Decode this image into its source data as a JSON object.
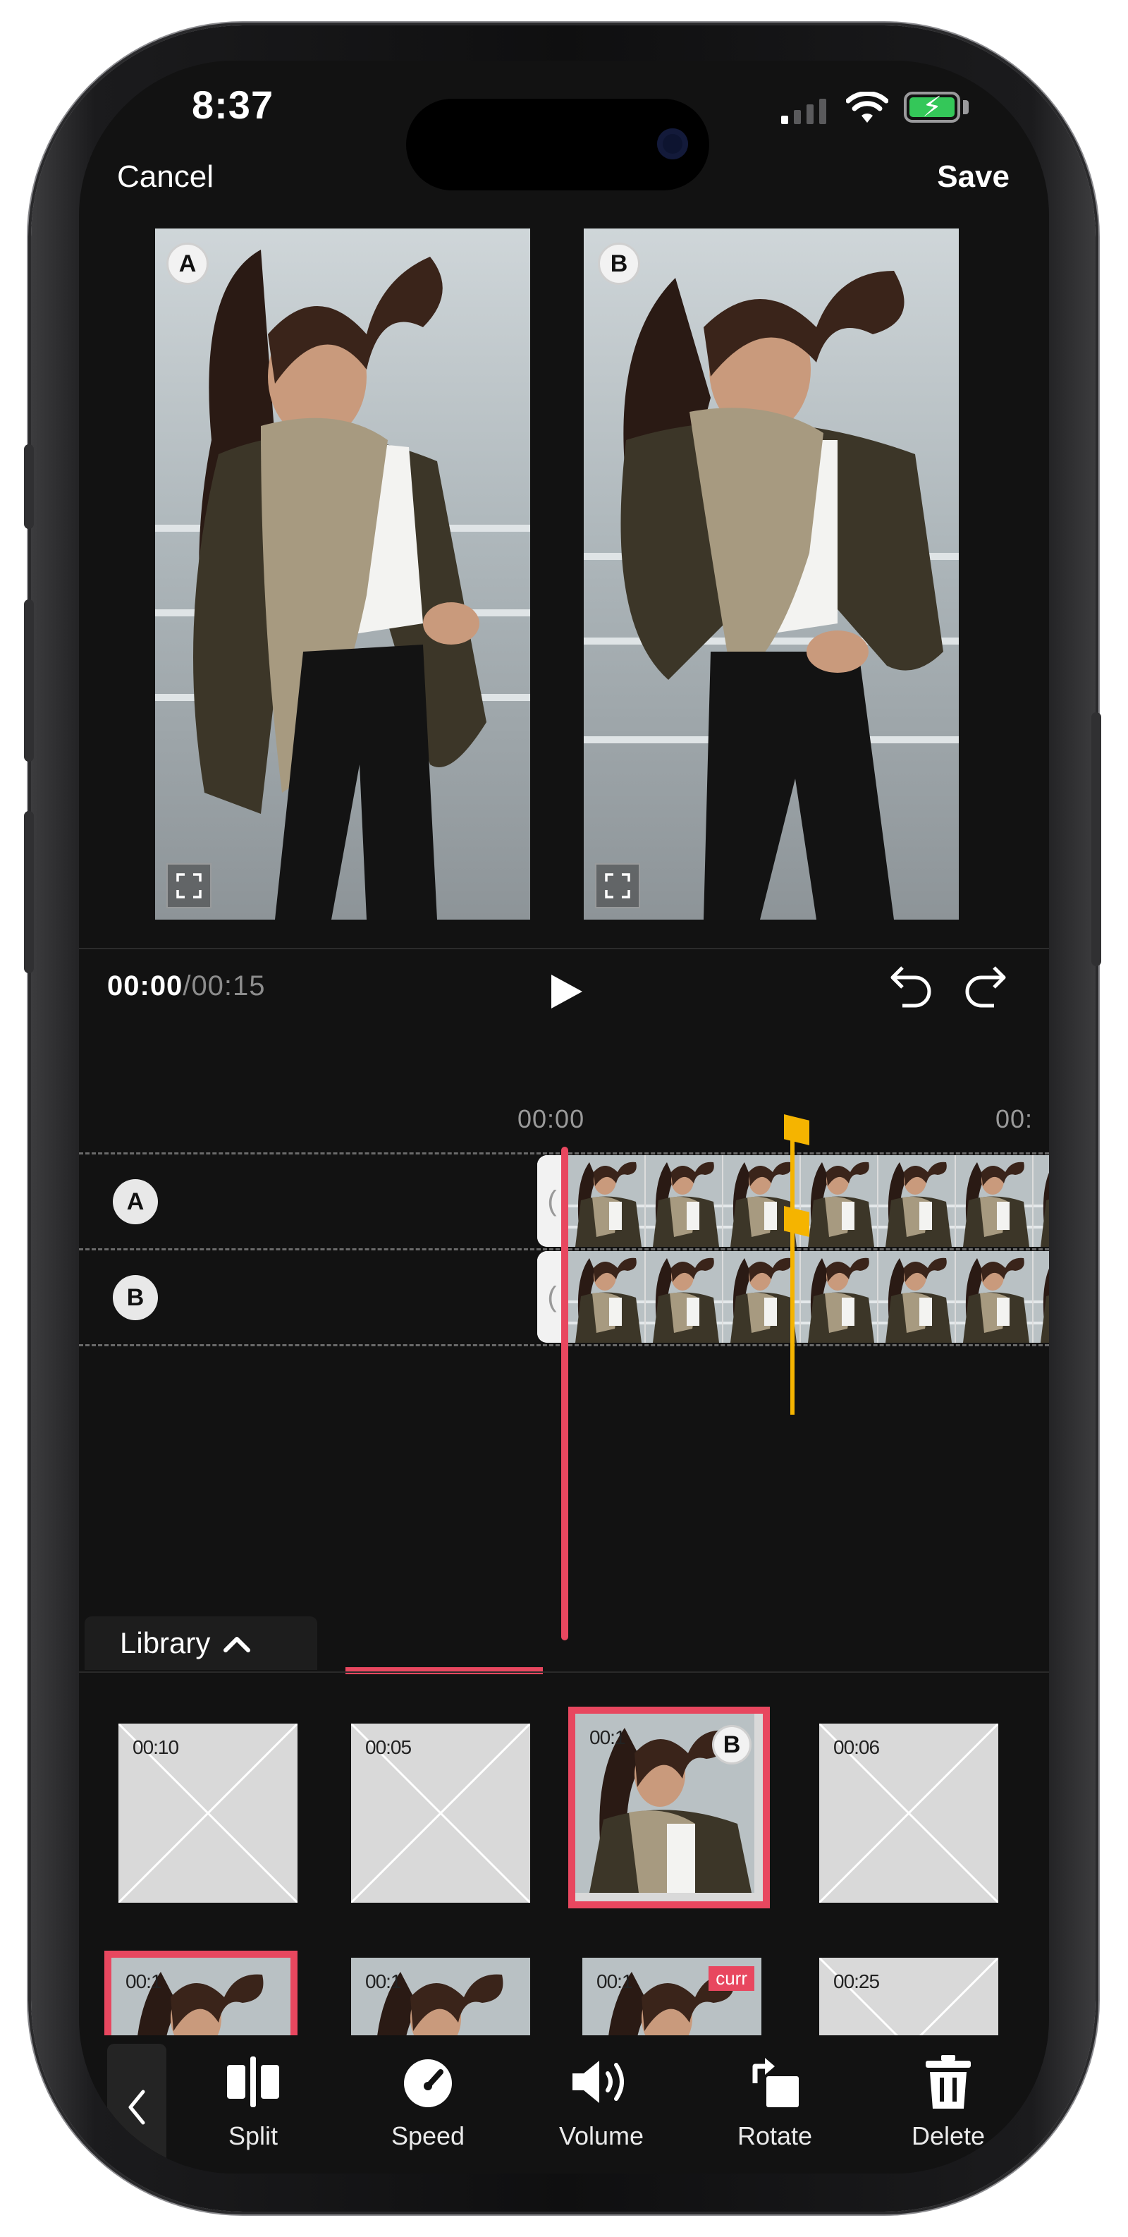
{
  "status_bar": {
    "time": "8:37"
  },
  "header": {
    "cancel_label": "Cancel",
    "save_label": "Save"
  },
  "previews": [
    {
      "badge": "A",
      "name": "A"
    },
    {
      "badge": "B",
      "name": "B"
    }
  ],
  "playback": {
    "current_time": "00:00",
    "separator": "/",
    "total_time": "00:15"
  },
  "timeline": {
    "ruler_labels": [
      "00:00",
      "00:"
    ],
    "tracks": [
      {
        "badge": "A"
      },
      {
        "badge": "B"
      }
    ],
    "clip_start_glyph": "("
  },
  "library": {
    "tab_label": "Library",
    "thumbnails_row1": [
      {
        "duration": "00:10",
        "type": "placeholder"
      },
      {
        "duration": "00:05",
        "type": "placeholder"
      },
      {
        "duration": "00:1",
        "type": "photo",
        "selected": true,
        "badge": "B"
      },
      {
        "duration": "00:06",
        "type": "placeholder"
      }
    ],
    "thumbnails_row2": [
      {
        "duration": "00:1",
        "type": "photo",
        "selected": true
      },
      {
        "duration": "00:1",
        "type": "photo"
      },
      {
        "duration": "00:1",
        "type": "photo",
        "tag": "curr"
      },
      {
        "duration": "00:25",
        "type": "placeholder"
      }
    ]
  },
  "toolbar": {
    "back_icon": "chevron-left-icon",
    "tools": [
      {
        "label": "Split",
        "icon": "split-icon"
      },
      {
        "label": "Speed",
        "icon": "speedometer-icon"
      },
      {
        "label": "Volume",
        "icon": "volume-icon"
      },
      {
        "label": "Rotate",
        "icon": "rotate-icon"
      },
      {
        "label": "Delete",
        "icon": "trash-icon"
      }
    ]
  },
  "colors": {
    "accent": "#e8475f",
    "marker": "#f5b400",
    "background": "#121212",
    "battery": "#34c759"
  }
}
